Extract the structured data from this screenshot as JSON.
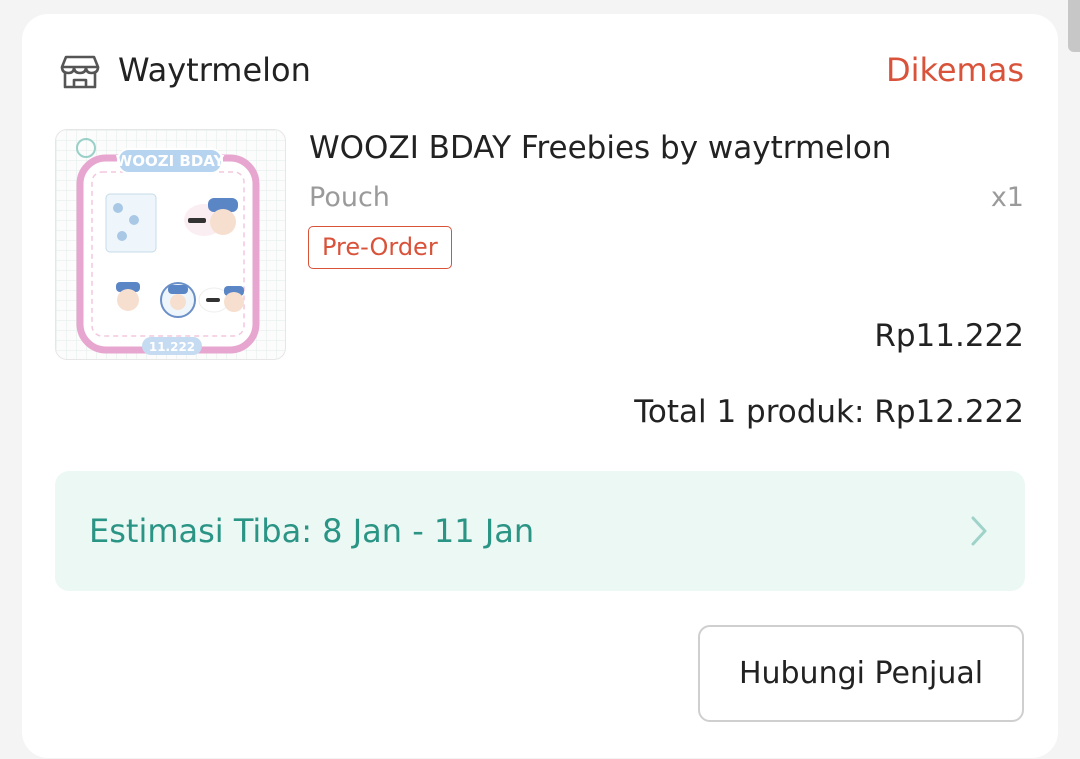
{
  "shop": {
    "name": "Waytrmelon",
    "icon": "store-icon"
  },
  "order": {
    "status": "Dikemas",
    "status_color": "#d9533b"
  },
  "product": {
    "title": "WOOZI BDAY Freebies by waytrmelon",
    "variant": "Pouch",
    "quantity": "x1",
    "badge": "Pre-Order",
    "price": "Rp11.222",
    "thumbnail": {
      "heading": "WOOZI BDAY",
      "tag": "11.222"
    }
  },
  "summary": {
    "total": "Total 1 produk: Rp12.222"
  },
  "delivery": {
    "estimate": "Estimasi Tiba: 8 Jan - 11 Jan",
    "accent_color": "#2a9485",
    "icon": "chevron-right-icon"
  },
  "actions": {
    "contact_seller": "Hubungi Penjual"
  }
}
